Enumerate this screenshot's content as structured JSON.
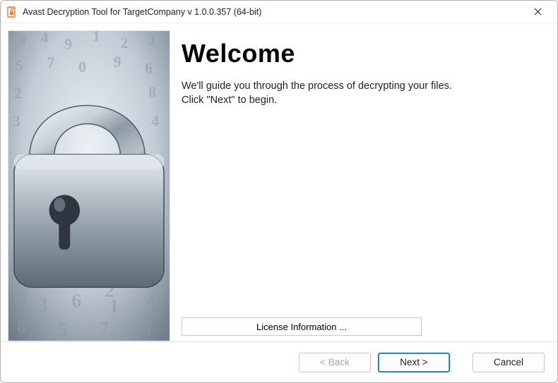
{
  "window": {
    "title": "Avast Decryption Tool for TargetCompany v 1.0.0.357 (64-bit)"
  },
  "content": {
    "heading": "Welcome",
    "line1": "We'll guide you through the process of decrypting your files.",
    "line2": "Click \"Next\" to begin.",
    "license_button": "License Information ..."
  },
  "footer": {
    "back": "< Back",
    "next": "Next >",
    "cancel": "Cancel"
  }
}
